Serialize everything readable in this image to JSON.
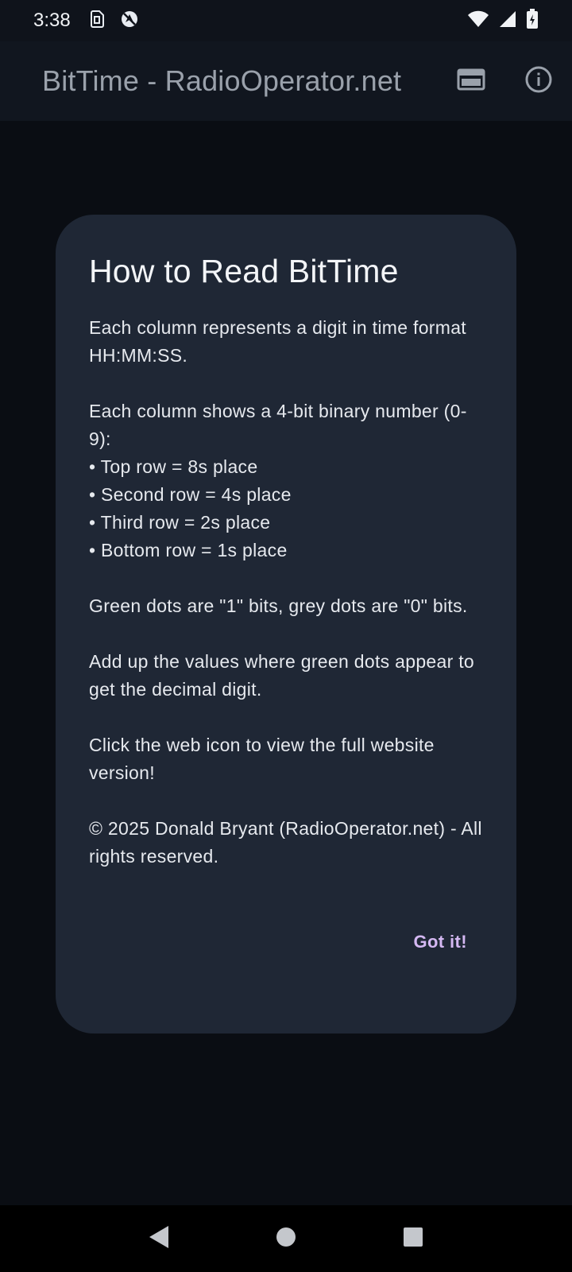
{
  "status_bar": {
    "time": "3:38",
    "left_icons": [
      "sim-card-icon",
      "no-location-icon"
    ],
    "right_icons": [
      "wifi-icon",
      "signal-icon",
      "battery-charging-icon"
    ]
  },
  "app_bar": {
    "title": "BitTime - RadioOperator.net",
    "actions": [
      "web-icon",
      "info-icon"
    ]
  },
  "dialog": {
    "title": "How to Read BitTime",
    "paragraph_1": "Each column represents a digit in time format HH:MM:SS.",
    "paragraph_2": "Each column shows a 4-bit binary number (0-9):",
    "bullets": [
      "• Top row = 8s place",
      "• Second row = 4s place",
      "• Third row = 2s place",
      "• Bottom row = 1s place"
    ],
    "paragraph_3": "Green dots are \"1\" bits, grey dots are \"0\" bits.",
    "paragraph_4": "Add up the values where green dots appear to get the decimal digit.",
    "paragraph_5": "Click the web icon to view the full website version!",
    "paragraph_6": "© 2025 Donald Bryant (RadioOperator.net) - All rights reserved.",
    "action_label": "Got it!"
  },
  "nav_bar": {
    "buttons": [
      "back-icon",
      "home-icon",
      "recents-icon"
    ]
  },
  "colors": {
    "background": "#0b0e14",
    "app_bar": "#11161f",
    "dialog": "#1f2735",
    "action": "#d4b8f2"
  }
}
